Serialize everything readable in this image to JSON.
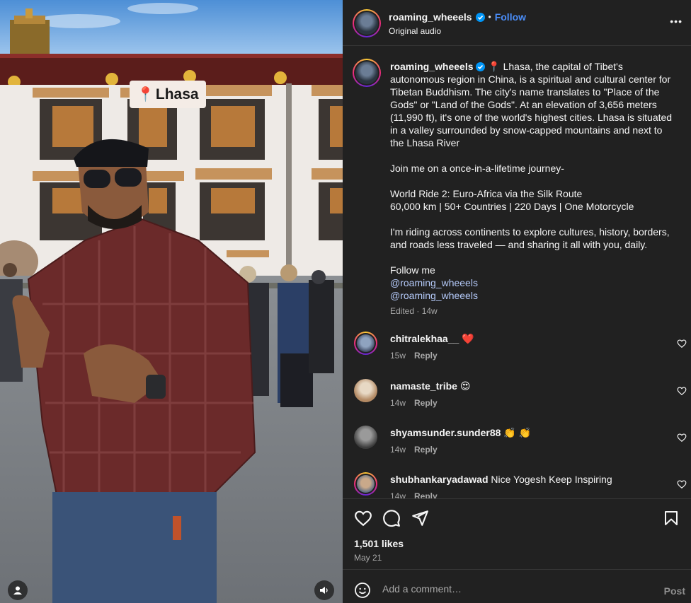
{
  "post": {
    "location_sticker": "Lhasa",
    "location_pin": "📍"
  },
  "header": {
    "username": "roaming_wheeels",
    "separator": "•",
    "follow_label": "Follow",
    "audio": "Original audio",
    "more": "•••"
  },
  "caption": {
    "username": "roaming_wheeels",
    "pin": "📍",
    "intro": "Lhasa, the capital of Tibet's autonomous region in China, is a spiritual and cultural center for Tibetan Buddhism. The city's name translates to \"Place of the Gods\" or \"Land of the Gods\". At an elevation of 3,656 meters (11,990 ft), it's one of the world's highest cities. Lhasa is situated in a valley surrounded by snow-capped mountains and next to the Lhasa River",
    "journey": "Join me on a once-in-a-lifetime journey-",
    "ride_title": "World Ride 2: Euro-Africa via the Silk Route",
    "ride_stats": "60,000 km | 50+ Countries | 220 Days | One Motorcycle",
    "mission": "I'm riding across continents to explore cultures, history, borders, and roads less traveled — and sharing it all with you, daily.",
    "follow_me": "Follow me",
    "mentions": [
      "@roaming_wheeels",
      "@roaming_wheeels"
    ],
    "edited": "Edited · 14w"
  },
  "comments": [
    {
      "username": "chitralekhaa__",
      "text": "",
      "emoji": "❤️",
      "age": "15w",
      "reply": "Reply"
    },
    {
      "username": "namaste_tribe",
      "text": "",
      "emoji": "😍",
      "age": "14w",
      "reply": "Reply"
    },
    {
      "username": "shyamsunder.sunder88",
      "text": "",
      "emoji": "👏 👏",
      "age": "14w",
      "reply": "Reply"
    },
    {
      "username": "shubhankaryadawad",
      "text": "Nice Yogesh Keep Inspiring",
      "emoji": "",
      "age": "14w",
      "reply": "Reply"
    }
  ],
  "stats": {
    "likes": "1,501 likes",
    "date": "May 21"
  },
  "composer": {
    "placeholder": "Add a comment…",
    "post_label": "Post"
  },
  "colors": {
    "panel_bg": "#212121",
    "link_blue": "#4a8df8",
    "mention_blue": "#b4c9f8",
    "muted": "#a8a8a8",
    "verified_blue": "#0095f6"
  },
  "icons": {
    "header_more": "more-horizontal-icon",
    "verified": "verified-badge-icon",
    "like": "heart-icon",
    "comment": "comment-bubble-icon",
    "share": "paper-plane-icon",
    "save": "bookmark-icon",
    "emoji": "smiley-icon",
    "user": "user-tag-icon",
    "audio": "speaker-icon"
  }
}
